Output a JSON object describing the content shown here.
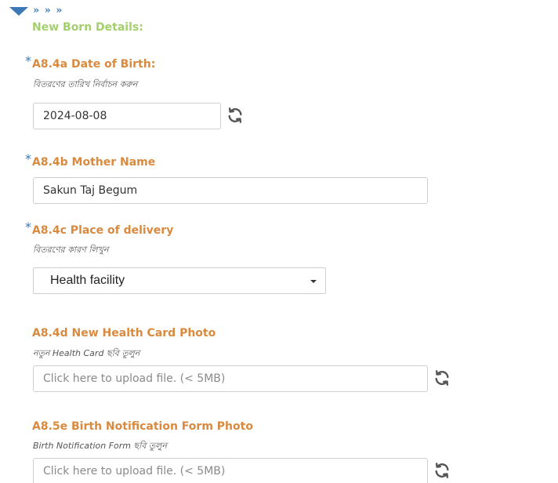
{
  "header": {
    "breadcrumb": "» » »",
    "section_title": "New Born Details:"
  },
  "fields": {
    "dob": {
      "required_mark": "*",
      "label": "A8.4a Date of Birth:",
      "hint": "বিতরণের তারিখ নির্বাচন করুন",
      "value": "2024-08-08",
      "reset_icon": "refresh-icon"
    },
    "mother_name": {
      "required_mark": "*",
      "label": "A8.4b Mother Name",
      "value": "Sakun Taj Begum"
    },
    "place_of_delivery": {
      "required_mark": "*",
      "label": "A8.4c Place of delivery",
      "hint": "বিতরণের কারণ লিখুন",
      "selected": "Health facility"
    },
    "health_card_photo": {
      "label": "A8.4d New Health Card Photo",
      "hint": "নতুন Health Card ছবি তুলুন",
      "placeholder": "Click here to upload file. (< 5MB)",
      "reset_icon": "refresh-icon"
    },
    "birth_notification_photo": {
      "label": "A8.5e Birth Notification Form Photo",
      "hint": "Birth Notification Form ছবি তুলুন",
      "placeholder": "Click here to upload file. (< 5MB)",
      "reset_icon": "refresh-icon"
    }
  },
  "colors": {
    "accent_blue": "#3b78b5",
    "section_green": "#a3d06b",
    "label_orange": "#d98a3f"
  }
}
